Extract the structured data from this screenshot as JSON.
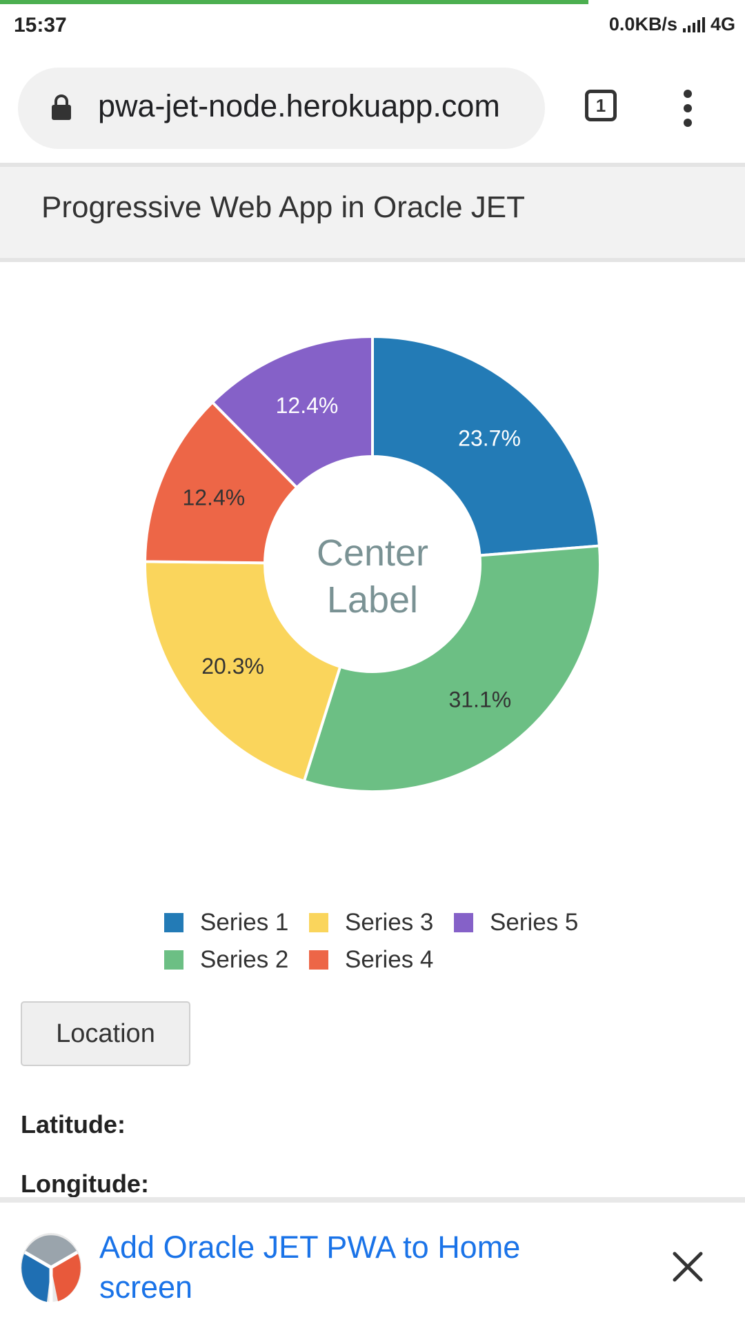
{
  "status_bar": {
    "time": "15:37",
    "speed": "0.0KB/s",
    "network": "4G",
    "page_load_progress": 0.79
  },
  "browser": {
    "url": "pwa-jet-node.herokuapp.com",
    "tab_count": "1",
    "icons": [
      "lock-icon",
      "tab-switcher-icon",
      "more-vert-icon"
    ]
  },
  "app": {
    "title": "Progressive Web App in Oracle JET"
  },
  "chart_data": {
    "type": "pie",
    "variant": "donut",
    "center_label": [
      "Center",
      "Label"
    ],
    "slices": [
      {
        "name": "Series 1",
        "value": 23.7,
        "label": "23.7%",
        "color": "#237bb6"
      },
      {
        "name": "Series 2",
        "value": 31.1,
        "label": "31.1%",
        "color": "#6cbf84"
      },
      {
        "name": "Series 3",
        "value": 20.3,
        "label": "20.3%",
        "color": "#fad55c"
      },
      {
        "name": "Series 4",
        "value": 12.4,
        "label": "12.4%",
        "color": "#ed6647"
      },
      {
        "name": "Series 5",
        "value": 12.4,
        "label": "12.4%",
        "color": "#8561c8"
      }
    ],
    "legend_position": "bottom",
    "label_colors": {
      "dark_background": "#ffffff",
      "light_background": "#333333"
    },
    "center_label_color": "#7a9294"
  },
  "legend": [
    {
      "label": "Series 1",
      "color": "#237bb6"
    },
    {
      "label": "Series 3",
      "color": "#fad55c"
    },
    {
      "label": "Series 5",
      "color": "#8561c8"
    },
    {
      "label": "Series 2",
      "color": "#6cbf84"
    },
    {
      "label": "Series 4",
      "color": "#ed6647"
    }
  ],
  "location": {
    "button_label": "Location",
    "latitude_label": "Latitude:",
    "longitude_label": "Longitude:"
  },
  "install_banner": {
    "text": "Add Oracle JET PWA to Home screen",
    "icons": [
      "oracle-jet-logo-icon",
      "close-icon"
    ]
  }
}
